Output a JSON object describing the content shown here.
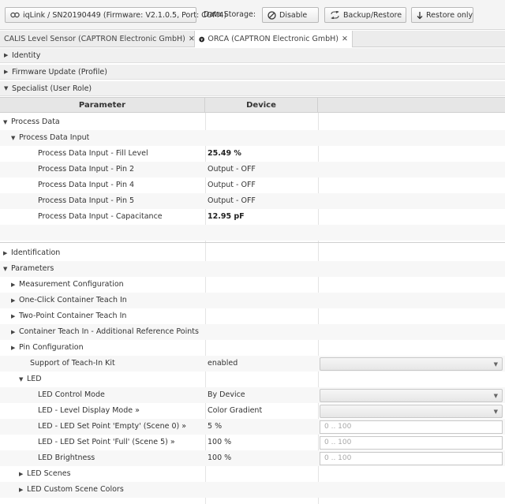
{
  "toolbar": {
    "device_label": "iqLink / SN20190449 (Firmware: V2.1.0.5, Port: COM4)",
    "data_storage_label": "Data Storage:",
    "disable_label": "Disable",
    "backup_label": "Backup/Restore",
    "restore_label": "Restore only"
  },
  "tabs": [
    {
      "label": "CALIS Level Sensor (CAPTRON Electronic GmbH)",
      "close": "✕"
    },
    {
      "label": "ORCA (CAPTRON Electronic GmbH)",
      "close": "✕"
    }
  ],
  "sections": {
    "identity": "Identity",
    "firmware": "Firmware Update (Profile)",
    "specialist": "Specialist (User Role)"
  },
  "grid": {
    "col_parameter": "Parameter",
    "col_device": "Device"
  },
  "rows": [
    {
      "label": "Process Data",
      "value": "",
      "expander": "▼"
    },
    {
      "label": "Process Data Input",
      "value": "",
      "expander": "▼"
    },
    {
      "label": "Process Data Input - Fill Level",
      "value": "25.49 %"
    },
    {
      "label": "Process Data Input - Pin 2",
      "value": "Output - OFF"
    },
    {
      "label": "Process Data Input - Pin 4",
      "value": "Output - OFF"
    },
    {
      "label": "Process Data Input - Pin 5",
      "value": "Output - OFF"
    },
    {
      "label": "Process Data Input - Capacitance",
      "value": "12.95 pF"
    },
    {
      "label": "",
      "value": ""
    },
    {
      "label": "Identification",
      "value": "",
      "expander": "▶"
    },
    {
      "label": "Parameters",
      "value": "",
      "expander": "▼"
    },
    {
      "label": "Measurement Configuration",
      "value": "",
      "expander": "▶"
    },
    {
      "label": "One-Click Container Teach In",
      "value": "",
      "expander": "▶"
    },
    {
      "label": "Two-Point Container Teach In",
      "value": "",
      "expander": "▶"
    },
    {
      "label": "Container Teach In - Additional Reference Points",
      "value": "",
      "expander": "▶"
    },
    {
      "label": "Pin Configuration",
      "value": "",
      "expander": "▶"
    },
    {
      "label": "Support of Teach-In Kit",
      "value": "enabled"
    },
    {
      "label": "LED",
      "value": "",
      "expander": "▼"
    },
    {
      "label": "LED Control Mode",
      "value": "By Device"
    },
    {
      "label": "LED - Level Display Mode »",
      "value": "Color Gradient"
    },
    {
      "label": "LED - LED Set Point 'Empty' (Scene 0) »",
      "value": "5 %",
      "range": "0 .. 100"
    },
    {
      "label": "LED - LED Set Point 'Full' (Scene 5) »",
      "value": "100 %",
      "range": "0 .. 100"
    },
    {
      "label": "LED Brightness",
      "value": "100 %",
      "range": "0 .. 100"
    },
    {
      "label": "LED Scenes",
      "value": "",
      "expander": "▶"
    },
    {
      "label": "LED Custom Scene Colors",
      "value": "",
      "expander": "▶"
    }
  ],
  "icons": {
    "link": "link-icon",
    "disable": "no-entry-icon",
    "backup": "backup-arrows-icon",
    "restore": "restore-arrow-icon",
    "orca": "orca-device-icon",
    "dropdown": "chevron-down-icon"
  },
  "colors": {
    "toolbar_bg": "#f4f4f4",
    "header_bg": "#e6e6e6",
    "alt_row": "#f7f7f7"
  }
}
